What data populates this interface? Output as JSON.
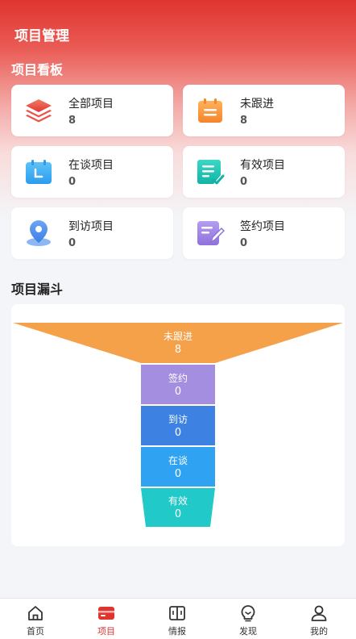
{
  "header": {
    "title": "项目管理"
  },
  "board": {
    "title": "项目看板",
    "cards": [
      {
        "label": "全部项目",
        "count": "8",
        "icon": "stack-icon"
      },
      {
        "label": "未跟进",
        "count": "8",
        "icon": "clipboard-icon"
      },
      {
        "label": "在谈项目",
        "count": "0",
        "icon": "calendar-icon"
      },
      {
        "label": "有效项目",
        "count": "0",
        "icon": "document-check-icon"
      },
      {
        "label": "到访项目",
        "count": "0",
        "icon": "location-pin-icon"
      },
      {
        "label": "签约项目",
        "count": "0",
        "icon": "document-pen-icon"
      }
    ]
  },
  "funnel": {
    "title": "项目漏斗",
    "stages": [
      {
        "label": "未跟进",
        "value": "8",
        "color": "#f5a14a"
      },
      {
        "label": "签约",
        "value": "0",
        "color": "#a48ee0"
      },
      {
        "label": "到访",
        "value": "0",
        "color": "#3d82e3"
      },
      {
        "label": "在谈",
        "value": "0",
        "color": "#2fa3f1"
      },
      {
        "label": "有效",
        "value": "0",
        "color": "#22c9c9"
      }
    ]
  },
  "tabbar": {
    "active_color": "#e0342f",
    "items": [
      {
        "label": "首页",
        "icon": "home-icon"
      },
      {
        "label": "项目",
        "icon": "project-card-icon"
      },
      {
        "label": "情报",
        "icon": "book-icon"
      },
      {
        "label": "发现",
        "icon": "bulb-icon"
      },
      {
        "label": "我的",
        "icon": "user-icon"
      }
    ]
  }
}
